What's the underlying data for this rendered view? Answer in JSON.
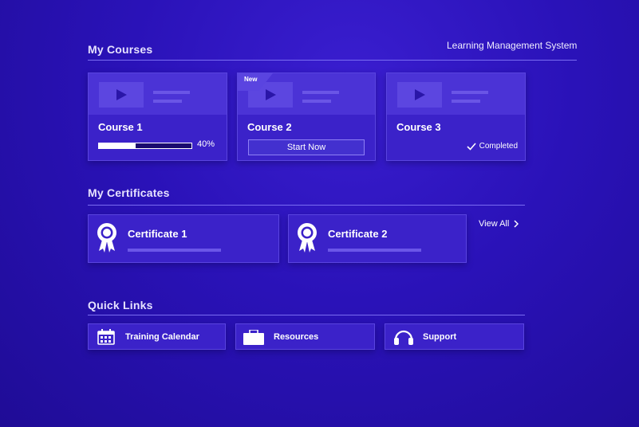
{
  "header": {
    "app_title": "Learning Management System"
  },
  "sections": {
    "courses_title": "My Courses",
    "certificates_title": "My Certificates",
    "quick_links_title": "Quick Links"
  },
  "courses": [
    {
      "title": "Course 1",
      "progress": 40,
      "progress_text": "40%"
    },
    {
      "title": "Course 2",
      "badge": "New",
      "action_label": "Start Now"
    },
    {
      "title": "Course 3",
      "status": "Completed"
    }
  ],
  "certificates": {
    "items": [
      {
        "title": "Certificate 1"
      },
      {
        "title": "Certificate 2"
      }
    ],
    "view_all": "View All"
  },
  "quick_links": [
    {
      "label": "Training Calendar",
      "icon": "calendar-icon"
    },
    {
      "label": "Resources",
      "icon": "briefcase-icon"
    },
    {
      "label": "Support",
      "icon": "headset-icon"
    }
  ],
  "colors": {
    "background": "#2a12b8",
    "card": "#3b22c9",
    "accent_line": "#7a6cf2"
  }
}
